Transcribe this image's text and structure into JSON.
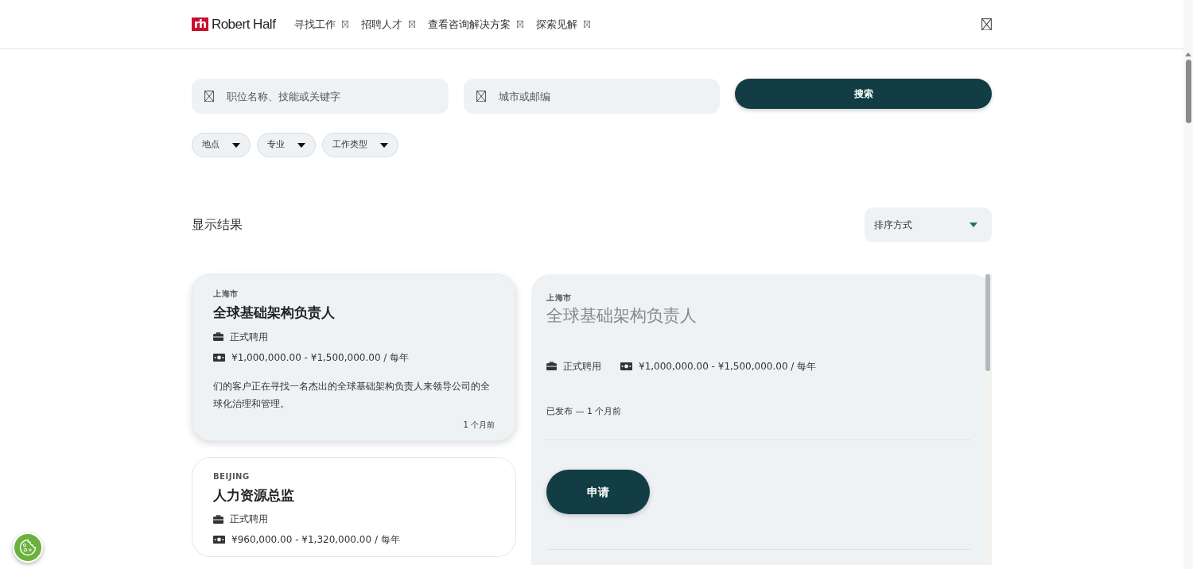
{
  "header": {
    "logo": {
      "mark": "rh",
      "text": "Robert Half"
    },
    "nav": [
      {
        "label": "寻找工作"
      },
      {
        "label": "招聘人才"
      },
      {
        "label": "查看咨询解决方案"
      },
      {
        "label": "探索见解"
      }
    ]
  },
  "search": {
    "keyword_placeholder": "职位名称、技能或关键字",
    "location_placeholder": "城市或邮编",
    "button": "搜索"
  },
  "filters": [
    {
      "label": "地点"
    },
    {
      "label": "专业"
    },
    {
      "label": "工作类型"
    }
  ],
  "results": {
    "title": "显示结果",
    "sort_placeholder": "排序方式"
  },
  "jobs": [
    {
      "location": "上海市",
      "title": "全球基础架构负责人",
      "type": "正式聘用",
      "salary": "¥1,000,000.00 - ¥1,500,000.00 / 每年",
      "description": "们的客户正在寻找一名杰出的全球基础架构负责人来领导公司的全球化治理和管理。",
      "posted": "1 个月前",
      "selected": true
    },
    {
      "location": "BEIJING",
      "title": "人力资源总监",
      "type": "正式聘用",
      "salary": "¥960,000.00 - ¥1,320,000.00 / 每年",
      "selected": false
    }
  ],
  "detail": {
    "location": "上海市",
    "title": "全球基础架构负责人",
    "type": "正式聘用",
    "salary": "¥1,000,000.00 - ¥1,500,000.00 / 每年",
    "posted": "已发布 — 1 个月前",
    "apply": "申请"
  }
}
